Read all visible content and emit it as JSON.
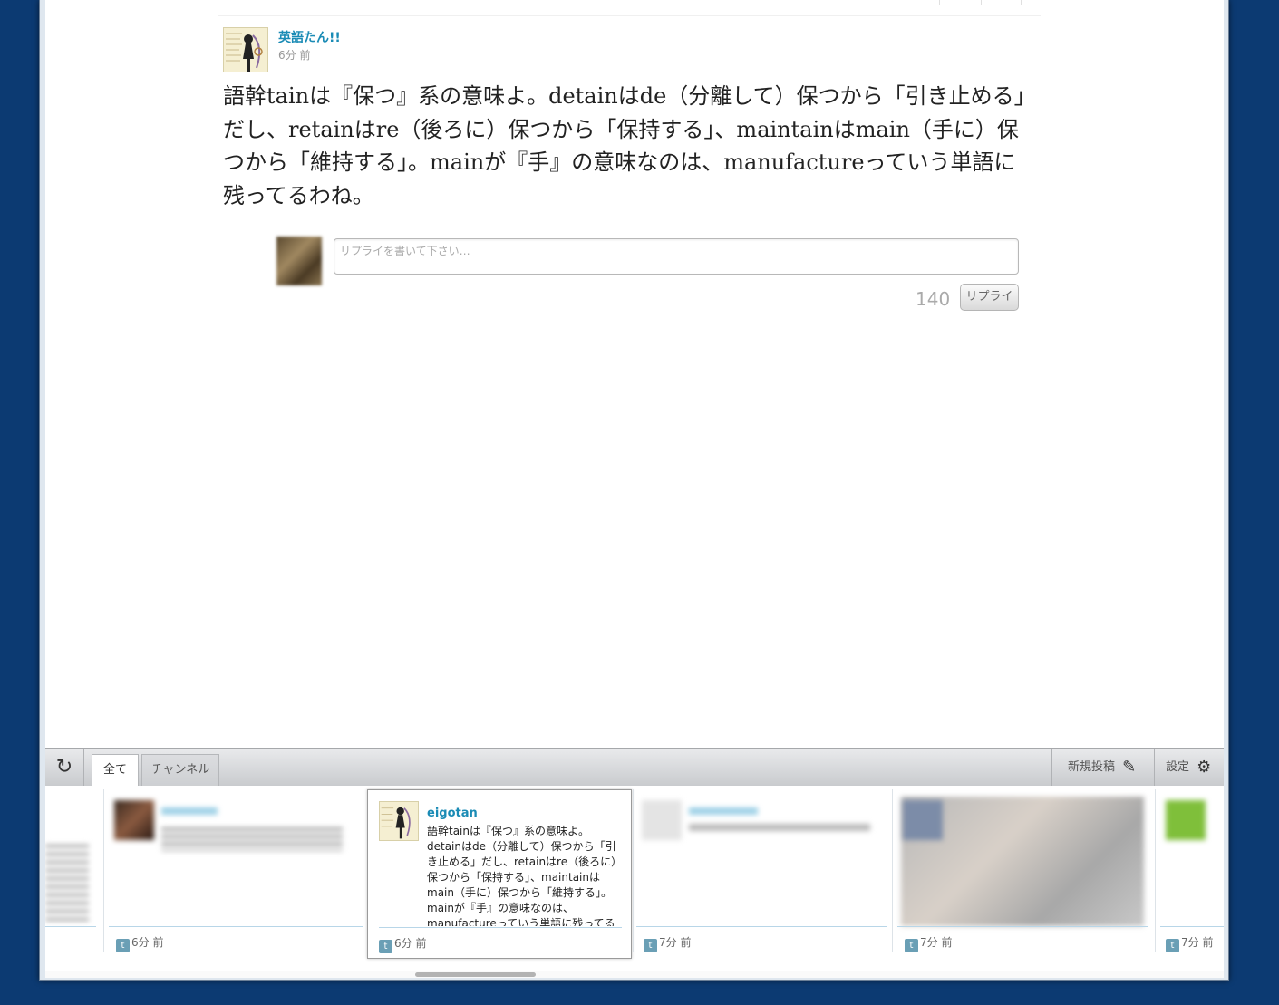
{
  "post": {
    "author": "英語たん!!",
    "time": "6分 前",
    "text": "語幹tainは『保つ』系の意味よ。detainはde（分離して）保つから「引き止める」だし、retainはre（後ろに）保つから「保持する」、maintainはmain（手に）保つから「維持する」。mainが『手』の意味なのは、manufactureっていう単語に残ってるわね。"
  },
  "reply": {
    "placeholder": "リプライを書いて下さい…",
    "counter": "140",
    "button": "リプライ"
  },
  "bar": {
    "refresh_icon": "↻",
    "tabs": [
      "全て",
      "チャンネル"
    ],
    "new_post": "新規投稿",
    "new_post_icon": "✎",
    "settings": "設定",
    "settings_icon": "⚙"
  },
  "cards": [
    {
      "time": "6分 前"
    },
    {
      "name": "eigotan",
      "text": "語幹tainは『保つ』系の意味よ。detainはde（分離して）保つから「引き止める」だし、retainはre（後ろに）保つから「保持する」、maintainはmain（手に）保つから「維持する」。mainが『手』の意味なのは、manufactureっていう単語に残ってる",
      "time": "6分 前"
    },
    {
      "time": "7分 前"
    },
    {
      "time": "7分 前"
    },
    {
      "time": "7分 前"
    }
  ],
  "colors": {
    "link": "#1a8bb5",
    "background": "#0c3a72"
  }
}
